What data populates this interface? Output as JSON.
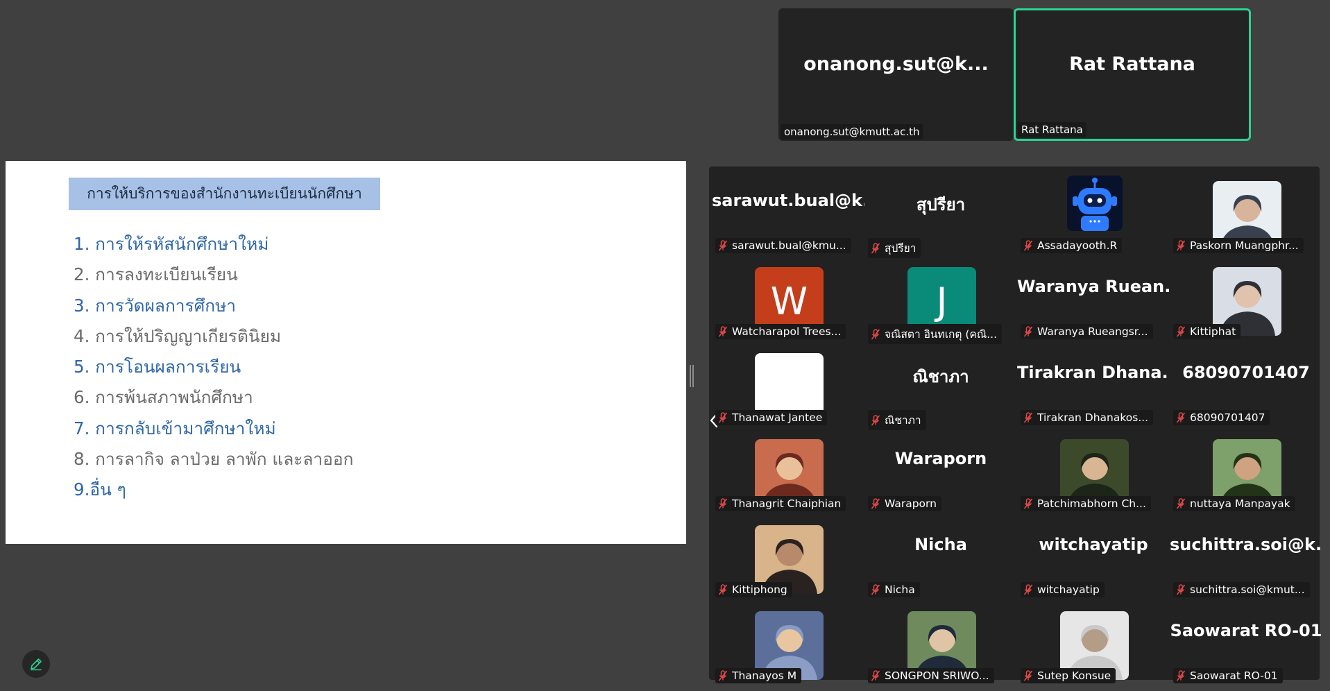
{
  "top_tiles": [
    {
      "display": "onanong.sut@k...",
      "caption": "onanong.sut@kmutt.ac.th",
      "active": false
    },
    {
      "display": "Rat Rattana",
      "caption": "Rat Rattana",
      "active": true
    }
  ],
  "slide": {
    "header": "การให้บริการของสำนักงานทะเบียนนักศึกษา",
    "items": [
      {
        "text": "1. การให้รหัสนักศึกษาใหม่",
        "color": "blue"
      },
      {
        "text": "2. การลงทะเบียนเรียน",
        "color": "gray"
      },
      {
        "text": "3. การวัดผลการศึกษา",
        "color": "blue"
      },
      {
        "text": "4. การให้ปริญญาเกียรตินิยม",
        "color": "gray"
      },
      {
        "text": "5. การโอนผลการเรียน",
        "color": "blue"
      },
      {
        "text": "6. การพ้นสภาพนักศึกษา",
        "color": "gray"
      },
      {
        "text": "7. การกลับเข้ามาศึกษาใหม่",
        "color": "blue"
      },
      {
        "text": "8. การลากิจ ลาป่วย ลาพัก และลาออก",
        "color": "gray"
      },
      {
        "text": "9.อื่น ๆ",
        "color": "blue"
      }
    ]
  },
  "colors": {
    "background": "#404040",
    "active_speaker_border": "#2bd494",
    "muted_mic": "#e04848",
    "slide_blue": "#2f66a8",
    "slide_gray": "#6b6b6b",
    "slide_header_bg": "#a7c0e6"
  },
  "gallery": {
    "participants": [
      {
        "display": "sarawut.bual@k...",
        "caption": "sarawut.bual@kmu...",
        "avatar": "none"
      },
      {
        "display": "สุปรียา",
        "caption": "สุปรียา",
        "avatar": "none"
      },
      {
        "display": "",
        "caption": "Assadayooth.R",
        "avatar": "robot-icon"
      },
      {
        "display": "",
        "caption": "Paskorn Muangphr...",
        "avatar": "photo"
      },
      {
        "display": "",
        "caption": "Watcharapol Trees...",
        "avatar": "letter",
        "letter": "W",
        "avatar_color": "#c43e1c"
      },
      {
        "display": "",
        "caption": "จณิสตา อินทเกตุ (คณิ...",
        "avatar": "letter",
        "letter": "J",
        "avatar_color": "#0a8a78"
      },
      {
        "display": "Waranya Ruean...",
        "caption": "Waranya Rueangsr...",
        "avatar": "none"
      },
      {
        "display": "",
        "caption": "Kittiphat",
        "avatar": "photo"
      },
      {
        "display": "",
        "caption": "Thanawat Jantee",
        "avatar": "blank"
      },
      {
        "display": "ณิชาภา",
        "caption": "ณิชาภา",
        "avatar": "none"
      },
      {
        "display": "Tirakran Dhana...",
        "caption": "Tirakran Dhanakos...",
        "avatar": "none"
      },
      {
        "display": "68090701407",
        "caption": "68090701407",
        "avatar": "none"
      },
      {
        "display": "",
        "caption": "Thanagrit Chaiphian",
        "avatar": "photo"
      },
      {
        "display": "Waraporn",
        "caption": "Waraporn",
        "avatar": "none"
      },
      {
        "display": "",
        "caption": "Patchimabhorn Ch...",
        "avatar": "photo"
      },
      {
        "display": "",
        "caption": "nuttaya Manpayak",
        "avatar": "photo"
      },
      {
        "display": "",
        "caption": "Kittiphong",
        "avatar": "photo"
      },
      {
        "display": "Nicha",
        "caption": "Nicha",
        "avatar": "none"
      },
      {
        "display": "witchayatip",
        "caption": "witchayatip",
        "avatar": "none"
      },
      {
        "display": "suchittra.soi@k...",
        "caption": "suchittra.soi@kmut...",
        "avatar": "none"
      },
      {
        "display": "",
        "caption": "Thanayos M",
        "avatar": "photo"
      },
      {
        "display": "",
        "caption": "SONGPON SRIWO...",
        "avatar": "photo"
      },
      {
        "display": "",
        "caption": "Sutep Konsue",
        "avatar": "photo"
      },
      {
        "display": "Saowarat RO-01",
        "caption": "Saowarat RO-01",
        "avatar": "none"
      }
    ]
  }
}
